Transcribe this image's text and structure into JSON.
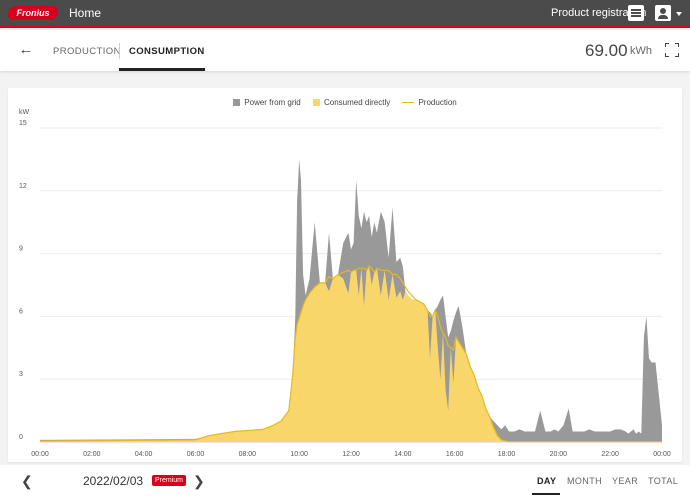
{
  "header": {
    "logo_text": "Fronius",
    "home_label": "Home",
    "product_registration_label": "Product registration"
  },
  "subheader": {
    "tabs": [
      {
        "label": "PRODUCTION",
        "active": false
      },
      {
        "label": "CONSUMPTION",
        "active": true
      }
    ],
    "total_value": "69.00",
    "total_unit": "kWh"
  },
  "footer": {
    "date": "2022/02/03",
    "premium_label": "Premium",
    "ranges": [
      {
        "label": "DAY",
        "active": true
      },
      {
        "label": "MONTH",
        "active": false
      },
      {
        "label": "YEAR",
        "active": false
      },
      {
        "label": "TOTAL",
        "active": false
      }
    ]
  },
  "colors": {
    "brand_red": "#d7001c",
    "header_bg": "#4b4b4b",
    "grid_power": "#999999",
    "consumed_directly": "#f9d66a",
    "production_line": "#e5b820"
  },
  "chart_data": {
    "type": "area",
    "y_unit": "kW",
    "ylim": [
      0,
      15
    ],
    "yticks": [
      0,
      3,
      6,
      9,
      12,
      15
    ],
    "xlim": [
      0,
      24
    ],
    "xticks": [
      "00:00",
      "02:00",
      "04:00",
      "06:00",
      "08:00",
      "10:00",
      "12:00",
      "14:00",
      "16:00",
      "18:00",
      "20:00",
      "22:00",
      "00:00"
    ],
    "legend_position": "top",
    "grid": true,
    "series": [
      {
        "name": "Power from grid",
        "kind": "stacked-area",
        "color": "#999999",
        "x": [
          0,
          6.0,
          6.5,
          7.0,
          7.5,
          8.0,
          8.6,
          9.0,
          9.3,
          9.6,
          9.75,
          9.85,
          9.92,
          10.0,
          10.07,
          10.15,
          10.25,
          10.4,
          10.6,
          10.8,
          11.0,
          11.15,
          11.3,
          11.5,
          11.7,
          11.9,
          12.0,
          12.1,
          12.2,
          12.3,
          12.4,
          12.5,
          12.6,
          12.7,
          12.8,
          12.9,
          13.0,
          13.15,
          13.3,
          13.45,
          13.6,
          13.75,
          13.9,
          14.0,
          14.1,
          14.2,
          14.35,
          14.5,
          14.65,
          14.8,
          14.95,
          15.05,
          15.15,
          15.25,
          15.35,
          15.45,
          15.55,
          15.65,
          15.75,
          15.85,
          15.95,
          16.05,
          16.15,
          16.3,
          16.45,
          16.6,
          16.75,
          16.9,
          17.05,
          17.2,
          17.35,
          17.5,
          17.65,
          17.8,
          17.95,
          18.1,
          18.3,
          18.5,
          18.7,
          18.9,
          19.1,
          19.3,
          19.5,
          19.7,
          19.85,
          20.0,
          20.2,
          20.4,
          20.55,
          20.7,
          20.85,
          21.0,
          21.2,
          21.4,
          21.6,
          21.8,
          22.0,
          22.2,
          22.4,
          22.6,
          22.7,
          22.8,
          22.9,
          23.0,
          23.1,
          23.2,
          23.3,
          23.4,
          23.5,
          23.6,
          23.75,
          24.0
        ],
        "values": [
          0.1,
          0.15,
          0.3,
          0.4,
          0.5,
          0.55,
          0.6,
          0.8,
          1.0,
          1.5,
          3.2,
          6.0,
          11.5,
          13.5,
          12.5,
          8.0,
          7.0,
          7.8,
          10.5,
          7.6,
          7.6,
          10.0,
          7.8,
          8.0,
          9.5,
          10.0,
          9.2,
          9.5,
          12.5,
          10.8,
          10.2,
          11.0,
          10.5,
          10.8,
          9.8,
          10.5,
          10.0,
          11.0,
          10.5,
          8.8,
          11.2,
          8.6,
          8.8,
          8.4,
          7.2,
          7.0,
          6.8,
          6.8,
          6.7,
          6.6,
          6.3,
          6.2,
          6.0,
          6.3,
          6.5,
          6.8,
          7.0,
          6.0,
          5.0,
          5.3,
          5.8,
          6.2,
          6.5,
          5.5,
          4.2,
          3.6,
          3.2,
          2.6,
          2.2,
          1.6,
          1.2,
          1.0,
          0.8,
          0.6,
          0.8,
          0.5,
          0.5,
          0.6,
          0.5,
          0.5,
          0.5,
          1.5,
          0.5,
          0.5,
          0.6,
          0.5,
          0.8,
          1.6,
          0.5,
          0.5,
          0.5,
          0.5,
          0.6,
          0.5,
          0.5,
          0.5,
          0.5,
          0.6,
          0.6,
          0.5,
          0.4,
          0.5,
          0.6,
          0.4,
          0.5,
          0.4,
          5.0,
          6.0,
          4.0,
          3.8,
          3.8,
          0.8
        ]
      },
      {
        "name": "Consumed directly",
        "kind": "area",
        "color": "#f9d66a",
        "x": [
          0,
          6.0,
          6.5,
          7.0,
          7.5,
          8.0,
          8.6,
          9.0,
          9.3,
          9.6,
          9.75,
          9.85,
          9.92,
          10.0,
          10.07,
          10.15,
          10.25,
          10.4,
          10.6,
          10.8,
          11.0,
          11.15,
          11.3,
          11.5,
          11.7,
          11.9,
          12.0,
          12.1,
          12.2,
          12.3,
          12.4,
          12.5,
          12.6,
          12.7,
          12.8,
          12.9,
          13.0,
          13.15,
          13.3,
          13.45,
          13.6,
          13.75,
          13.9,
          14.0,
          14.1,
          14.2,
          14.35,
          14.5,
          14.65,
          14.8,
          14.95,
          15.05,
          15.15,
          15.25,
          15.35,
          15.45,
          15.55,
          15.65,
          15.75,
          15.85,
          15.95,
          16.05,
          16.15,
          16.3,
          16.45,
          16.6,
          16.75,
          16.9,
          17.05,
          17.2,
          17.35,
          17.5,
          17.65,
          17.8,
          17.95,
          18.1,
          18.3,
          18.5,
          18.7,
          18.9,
          19.1,
          19.3,
          19.5,
          19.7,
          19.85,
          20.0,
          20.2,
          20.4,
          20.55,
          20.7,
          20.85,
          21.0,
          21.2,
          21.4,
          21.6,
          21.8,
          22.0,
          22.2,
          22.4,
          22.6,
          22.7,
          22.8,
          22.9,
          23.0,
          23.1,
          23.2,
          23.3,
          23.4,
          23.5,
          23.6,
          23.75,
          24.0
        ],
        "values": [
          0.05,
          0.1,
          0.3,
          0.4,
          0.5,
          0.55,
          0.6,
          0.8,
          1.0,
          1.5,
          3.2,
          5.0,
          5.6,
          5.9,
          6.2,
          6.5,
          6.8,
          7.1,
          7.4,
          7.6,
          7.6,
          7.2,
          7.8,
          8.0,
          7.8,
          7.1,
          8.1,
          8.2,
          8.2,
          7.0,
          8.3,
          6.5,
          8.2,
          8.4,
          7.5,
          8.1,
          8.3,
          7.0,
          8.2,
          6.8,
          8.0,
          6.9,
          7.2,
          6.8,
          7.2,
          7.0,
          6.8,
          6.8,
          6.7,
          6.6,
          6.3,
          4.0,
          6.0,
          6.3,
          4.5,
          3.0,
          5.2,
          2.5,
          1.5,
          4.5,
          2.8,
          5.0,
          4.8,
          4.5,
          4.2,
          3.6,
          3.2,
          2.6,
          2.2,
          1.6,
          1.2,
          0.7,
          0.3,
          0.1,
          0.05,
          0.02,
          0.02,
          0.02,
          0.02,
          0.02,
          0.02,
          0.02,
          0.02,
          0.02,
          0.02,
          0.02,
          0.02,
          0.02,
          0.02,
          0.02,
          0.02,
          0.02,
          0.02,
          0.02,
          0.02,
          0.02,
          0.02,
          0.02,
          0.02,
          0.02,
          0.02,
          0.02,
          0.02,
          0.02,
          0.02,
          0.02,
          0.02,
          0.02,
          0.02,
          0.02,
          0.02,
          0.02
        ]
      },
      {
        "name": "Production",
        "kind": "line",
        "color": "#e5b820",
        "x": [
          0,
          6.0,
          6.5,
          7.0,
          7.5,
          8.0,
          8.6,
          9.0,
          9.3,
          9.6,
          9.75,
          9.85,
          9.92,
          10.0,
          10.07,
          10.15,
          10.25,
          10.4,
          10.6,
          10.8,
          11.0,
          11.15,
          11.3,
          11.5,
          11.7,
          11.9,
          12.0,
          12.1,
          12.2,
          12.3,
          12.4,
          12.5,
          12.6,
          12.7,
          12.8,
          12.9,
          13.0,
          13.15,
          13.3,
          13.45,
          13.6,
          13.75,
          13.9,
          14.0,
          14.1,
          14.2,
          14.35,
          14.5,
          14.65,
          14.8,
          14.95,
          15.05,
          15.15,
          15.25,
          15.35,
          15.45,
          15.55,
          15.65,
          15.75,
          15.85,
          15.95,
          16.05,
          16.15,
          16.3,
          16.45,
          16.6,
          16.75,
          16.9,
          17.05,
          17.2,
          17.35,
          17.5,
          17.65,
          17.8,
          17.95,
          18.1,
          18.3,
          18.5,
          18.7,
          18.9,
          19.1,
          19.3,
          19.5,
          19.7,
          19.85,
          20.0,
          20.2,
          20.4,
          20.55,
          20.7,
          20.85,
          21.0,
          21.2,
          21.4,
          21.6,
          21.8,
          22.0,
          22.2,
          22.4,
          22.6,
          22.7,
          22.8,
          22.9,
          23.0,
          23.1,
          23.2,
          23.3,
          23.4,
          23.5,
          23.6,
          23.75,
          24.0
        ],
        "values": [
          0.05,
          0.1,
          0.3,
          0.4,
          0.5,
          0.55,
          0.6,
          0.8,
          1.0,
          1.5,
          3.2,
          5.0,
          5.6,
          5.9,
          6.2,
          6.5,
          6.8,
          7.1,
          7.4,
          7.6,
          7.6,
          7.9,
          7.8,
          8.0,
          8.1,
          8.2,
          8.1,
          8.2,
          8.2,
          8.3,
          8.3,
          8.3,
          8.2,
          8.4,
          8.3,
          8.1,
          8.3,
          8.2,
          8.2,
          8.2,
          8.0,
          8.0,
          7.8,
          7.6,
          7.4,
          7.2,
          7.0,
          6.8,
          6.7,
          6.6,
          6.3,
          6.0,
          6.0,
          6.3,
          6.0,
          5.5,
          5.2,
          5.0,
          4.6,
          4.5,
          4.4,
          5.0,
          4.8,
          4.5,
          4.2,
          3.6,
          3.2,
          2.6,
          2.2,
          1.6,
          1.2,
          0.7,
          0.3,
          0.1,
          0.05,
          0.02,
          0.02,
          0.02,
          0.02,
          0.02,
          0.02,
          0.02,
          0.02,
          0.02,
          0.02,
          0.02,
          0.02,
          0.02,
          0.02,
          0.02,
          0.02,
          0.02,
          0.02,
          0.02,
          0.02,
          0.02,
          0.02,
          0.02,
          0.02,
          0.02,
          0.02,
          0.02,
          0.02,
          0.02,
          0.02,
          0.02,
          0.02,
          0.02,
          0.02,
          0.02,
          0.02,
          0.02
        ]
      }
    ]
  }
}
